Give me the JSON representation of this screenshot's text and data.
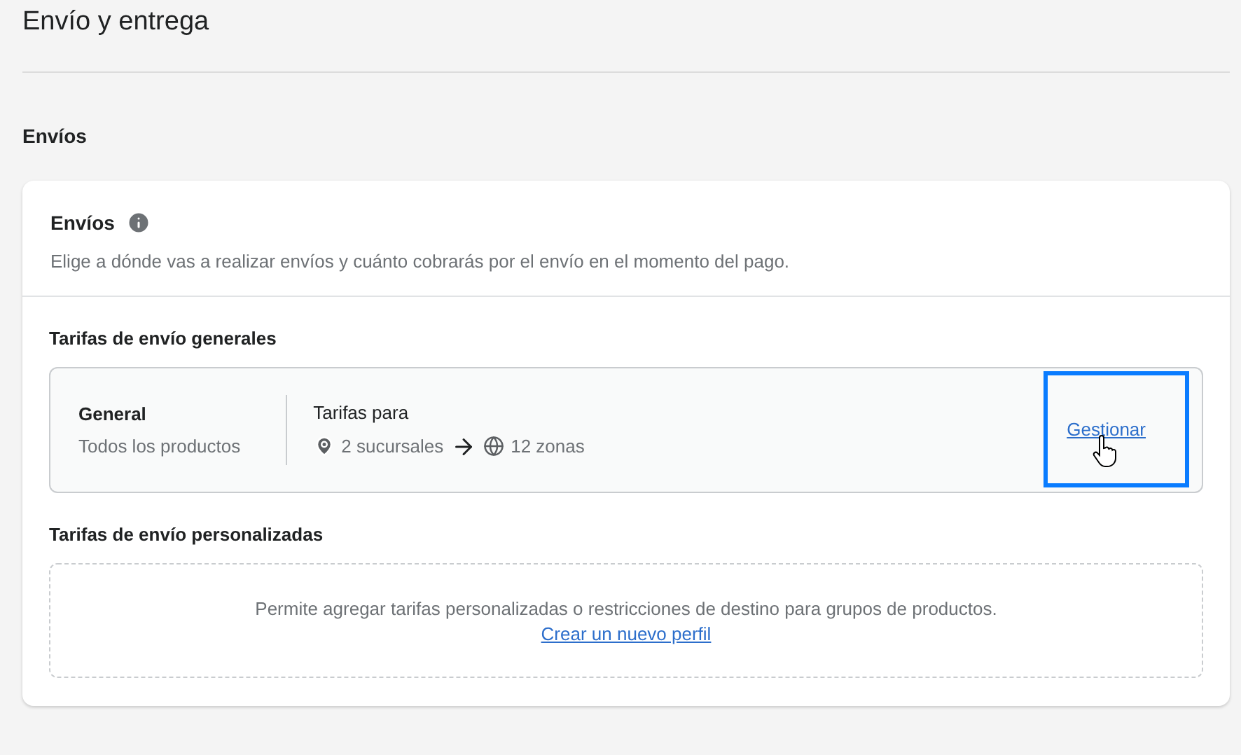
{
  "page": {
    "title": "Envío y entrega"
  },
  "section": {
    "title": "Envíos"
  },
  "card": {
    "title": "Envíos",
    "description": "Elige a dónde vas a realizar envíos y cuánto cobrarás por el envío en el momento del pago.",
    "general_rates": {
      "title": "Tarifas de envío generales",
      "profile": {
        "name": "General",
        "subtitle": "Todos los productos",
        "rates_label": "Tarifas para",
        "origins": "2 sucursales",
        "zones": "12 zonas",
        "manage_link": {
          "label": "Gestionar",
          "highlighted": true,
          "cursor": true
        }
      }
    },
    "custom_rates": {
      "title": "Tarifas de envío personalizadas",
      "message": "Permite agregar tarifas personalizadas o restricciones de destino para grupos de productos.",
      "link": "Crear un nuevo perfil"
    }
  }
}
